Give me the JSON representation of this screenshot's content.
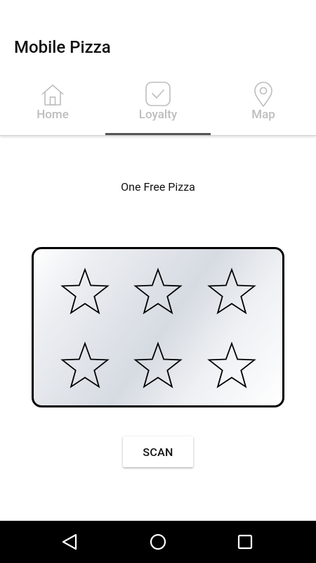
{
  "app": {
    "title": "Mobile Pizza"
  },
  "tabs": [
    {
      "label": "Home",
      "icon": "home-icon"
    },
    {
      "label": "Loyalty",
      "icon": "check-badge-icon",
      "selected": true
    },
    {
      "label": "Map",
      "icon": "map-pin-icon"
    }
  ],
  "loyalty": {
    "reward_title": "One Free Pizza",
    "stamps_total": 6,
    "stamps_filled": 0,
    "stamp_icon": "star-outline-icon"
  },
  "actions": {
    "scan_label": "SCAN"
  },
  "system_nav": {
    "back_icon": "back-triangle-icon",
    "home_icon": "home-circle-icon",
    "recents_icon": "recents-square-icon"
  },
  "colors": {
    "tab_inactive": "#bdbdbd",
    "tab_indicator": "#555555",
    "card_border": "#000000",
    "nav_bar": "#000000"
  }
}
